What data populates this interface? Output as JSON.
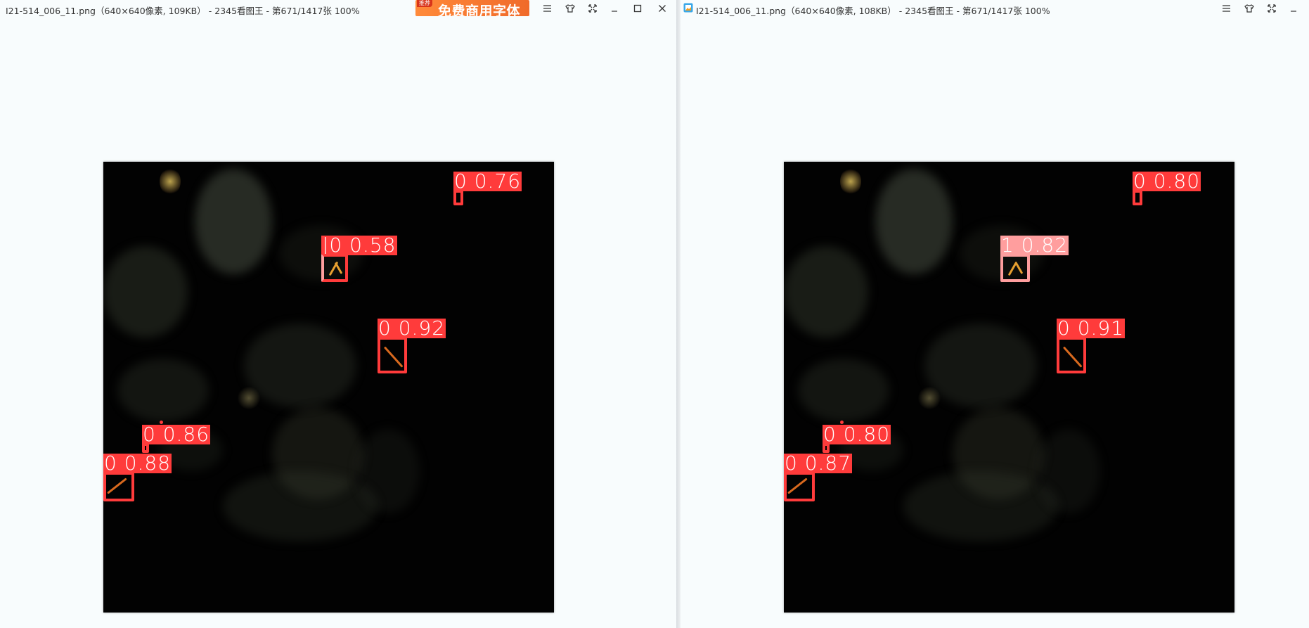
{
  "left": {
    "title": "I21-514_006_11.png（640×640像素, 109KB） - 2345看图王 - 第671/1417张 100%",
    "ad": {
      "tag": "推荐",
      "text": "免费商用字体"
    },
    "detections": [
      {
        "label": "0 0.76"
      },
      {
        "label": "|0 0.58"
      },
      {
        "label": "0 0.92"
      },
      {
        "label": "0 0.86"
      },
      {
        "label": "0 0.88"
      }
    ]
  },
  "right": {
    "title": "I21-514_006_11.png（640×640像素, 108KB） - 2345看图王 - 第671/1417张 100%",
    "detections": [
      {
        "label": "0 0.80"
      },
      {
        "label": "1 0.82"
      },
      {
        "label": "0 0.91"
      },
      {
        "label": "0 0.80"
      },
      {
        "label": "0 0.87"
      }
    ]
  },
  "toolbar": {
    "menu_icon": "≡",
    "skin_icon": "⌂",
    "fullscreen_icon": "⤢",
    "minimize_icon": "–",
    "maximize_icon": "☐",
    "close_icon": "✕"
  },
  "colors": {
    "class0": "#ff3b3b",
    "class1": "#ff9e9e"
  }
}
